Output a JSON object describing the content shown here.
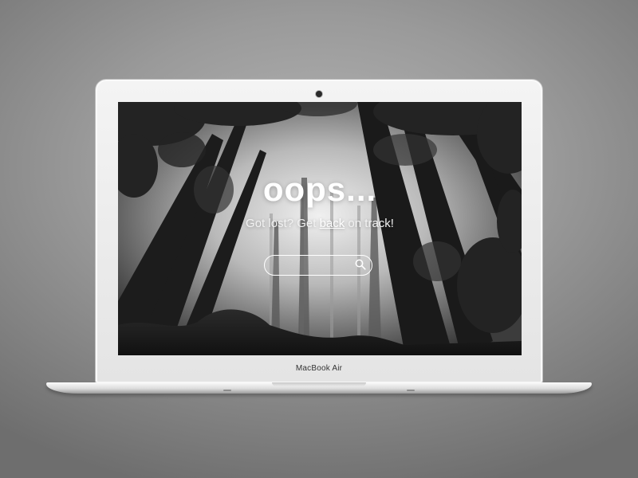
{
  "device": {
    "brand_label": "MacBook Air"
  },
  "page": {
    "title": "oops...",
    "subtitle_before": "Got lost? Get ",
    "subtitle_link": "back",
    "subtitle_after": " on track!",
    "search": {
      "value": "",
      "placeholder": ""
    }
  },
  "icons": {
    "search": "search-icon",
    "camera": "camera-icon"
  },
  "colors": {
    "background": "#9a9a9a",
    "laptop_frame": "#ececec",
    "text": "#ffffff"
  }
}
